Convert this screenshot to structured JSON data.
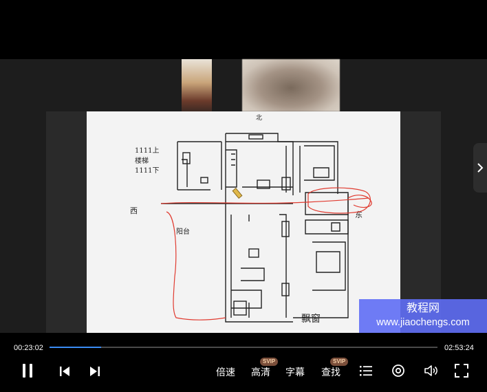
{
  "player": {
    "current_time": "00:23:02",
    "total_time": "02:53:24",
    "progress": 0.1329,
    "accent": "#3a8cf5",
    "controls": {
      "speed_label": "倍速",
      "quality_label": "高清",
      "quality_badge": "SVIP",
      "subtitle_label": "字幕",
      "search_label": "查找",
      "search_badge": "SVIP"
    }
  },
  "sketch": {
    "labels": {
      "north": "北",
      "west": "西",
      "east": "东",
      "floors": "1111上",
      "stairs": "楼梯",
      "floors2": "1111下",
      "bay_window": "飘窗",
      "balcony": "阳台"
    }
  },
  "watermark": {
    "name": "教程网",
    "url": "www.jiaochengs.com",
    "color": "#5f6ef5"
  }
}
